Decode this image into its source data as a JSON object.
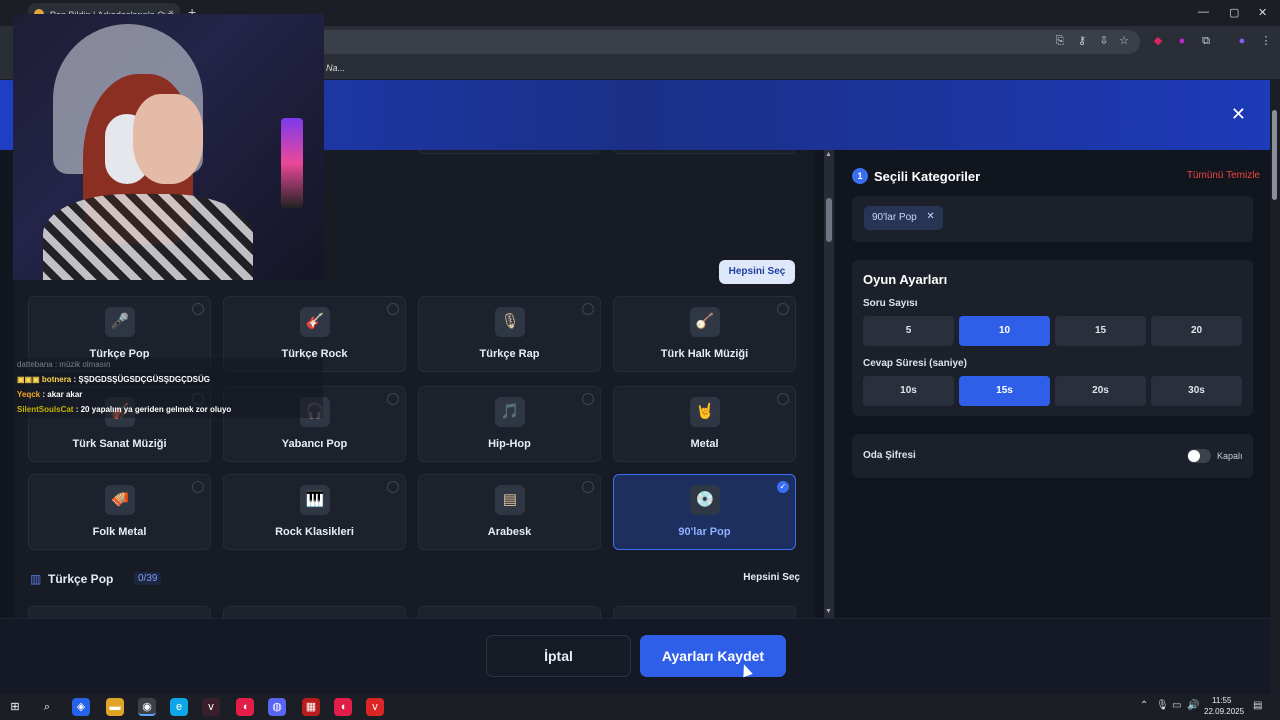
{
  "browser": {
    "tab_title": "Pop Bildin | Arkadaşlarınla Oyu...",
    "tab_close": "×",
    "new_tab": "+",
    "bookmark_text": "Na..."
  },
  "modal": {
    "close": "✕",
    "select_all_button": "Hepsini Seç",
    "categories": [
      {
        "label": "Türkçe Pop",
        "icon": "🎤",
        "selected": false
      },
      {
        "label": "Türkçe Rock",
        "icon": "🎸",
        "selected": false
      },
      {
        "label": "Türkçe Rap",
        "icon": "🎙",
        "selected": false
      },
      {
        "label": "Türk Halk Müziği",
        "icon": "🪕",
        "selected": false
      },
      {
        "label": "Türk Sanat Müziği",
        "icon": "🎻",
        "selected": false
      },
      {
        "label": "Yabancı Pop",
        "icon": "🎧",
        "selected": false
      },
      {
        "label": "Hip-Hop",
        "icon": "🎵",
        "selected": false
      },
      {
        "label": "Metal",
        "icon": "🤘",
        "selected": false
      },
      {
        "label": "Folk Metal",
        "icon": "🪗",
        "selected": false
      },
      {
        "label": "Rock Klasikleri",
        "icon": "🎹",
        "selected": false
      },
      {
        "label": "Arabesk",
        "icon": "▤",
        "selected": false
      },
      {
        "label": "90'lar Pop",
        "icon": "💿",
        "selected": true
      }
    ],
    "section": {
      "icon": "▥",
      "title": "Türkçe Pop",
      "count": "0/39",
      "select_all": "Hepsini Seç"
    },
    "selected_panel": {
      "number": "1",
      "title": "Seçili Kategoriler",
      "clear_all": "Tümünü Temizle",
      "chips": [
        "90'lar Pop"
      ],
      "chip_remove": "✕"
    },
    "game_settings": {
      "title": "Oyun Ayarları",
      "question_count_label": "Soru Sayısı",
      "question_counts": [
        "5",
        "10",
        "15",
        "20"
      ],
      "question_count_selected": "10",
      "answer_time_label": "Cevap Süresi (saniye)",
      "answer_times": [
        "10s",
        "15s",
        "20s",
        "30s"
      ],
      "answer_time_selected": "15s"
    },
    "room_password": {
      "label": "Oda Şifresi",
      "state": "Kapalı"
    },
    "footer": {
      "cancel": "İptal",
      "save": "Ayarları Kaydet"
    }
  },
  "chat": [
    {
      "user": "dattebana",
      "text": ": müzik olmasın",
      "dim": true
    },
    {
      "user": "botnera",
      "text": ": ŞŞDGDSŞÜGSDÇGÜSŞDGÇDSÜG",
      "dim": false
    },
    {
      "user": "Yeqck",
      "text": ": akar akar",
      "dim": false
    },
    {
      "user": "SilentSoulsCat",
      "text": ": 20 yapalım ya geriden gelmek zor oluyo",
      "dim": false
    }
  ],
  "taskbar": {
    "time": "11:55",
    "date": "22.09.2025"
  },
  "colors": {
    "accent": "#2f5fe8",
    "danger": "#ef4444",
    "header_gradient": "#1e3ec4"
  }
}
